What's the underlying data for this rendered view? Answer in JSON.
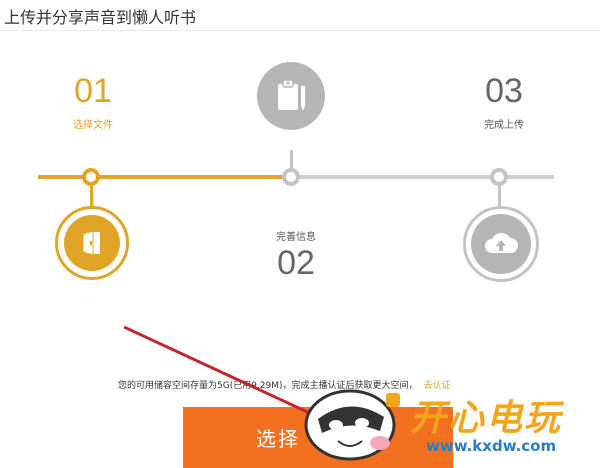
{
  "page": {
    "title": "上传并分享声音到懒人听书"
  },
  "steps": [
    {
      "number": "01",
      "label": "选择文件",
      "state": "active"
    },
    {
      "number": "02",
      "label": "完善信息",
      "state": "inactive"
    },
    {
      "number": "03",
      "label": "完成上传",
      "state": "inactive"
    }
  ],
  "storage": {
    "info": "您的可用储容空间存量为5G(已用9.29M)，完成主播认证后获取更大空间，",
    "link": "去认证"
  },
  "actions": {
    "select_label": "选择"
  },
  "watermark": {
    "brand": "开心电玩",
    "url": "www.kxdw.com"
  },
  "icons": {
    "step1": "file-door-icon",
    "step2": "clipboard-pen-icon",
    "step3": "cloud-upload-icon"
  },
  "colors": {
    "active": "#e0a426",
    "inactive": "#c3c3c3",
    "button": "#f2701f",
    "arrow": "#c0272d"
  }
}
